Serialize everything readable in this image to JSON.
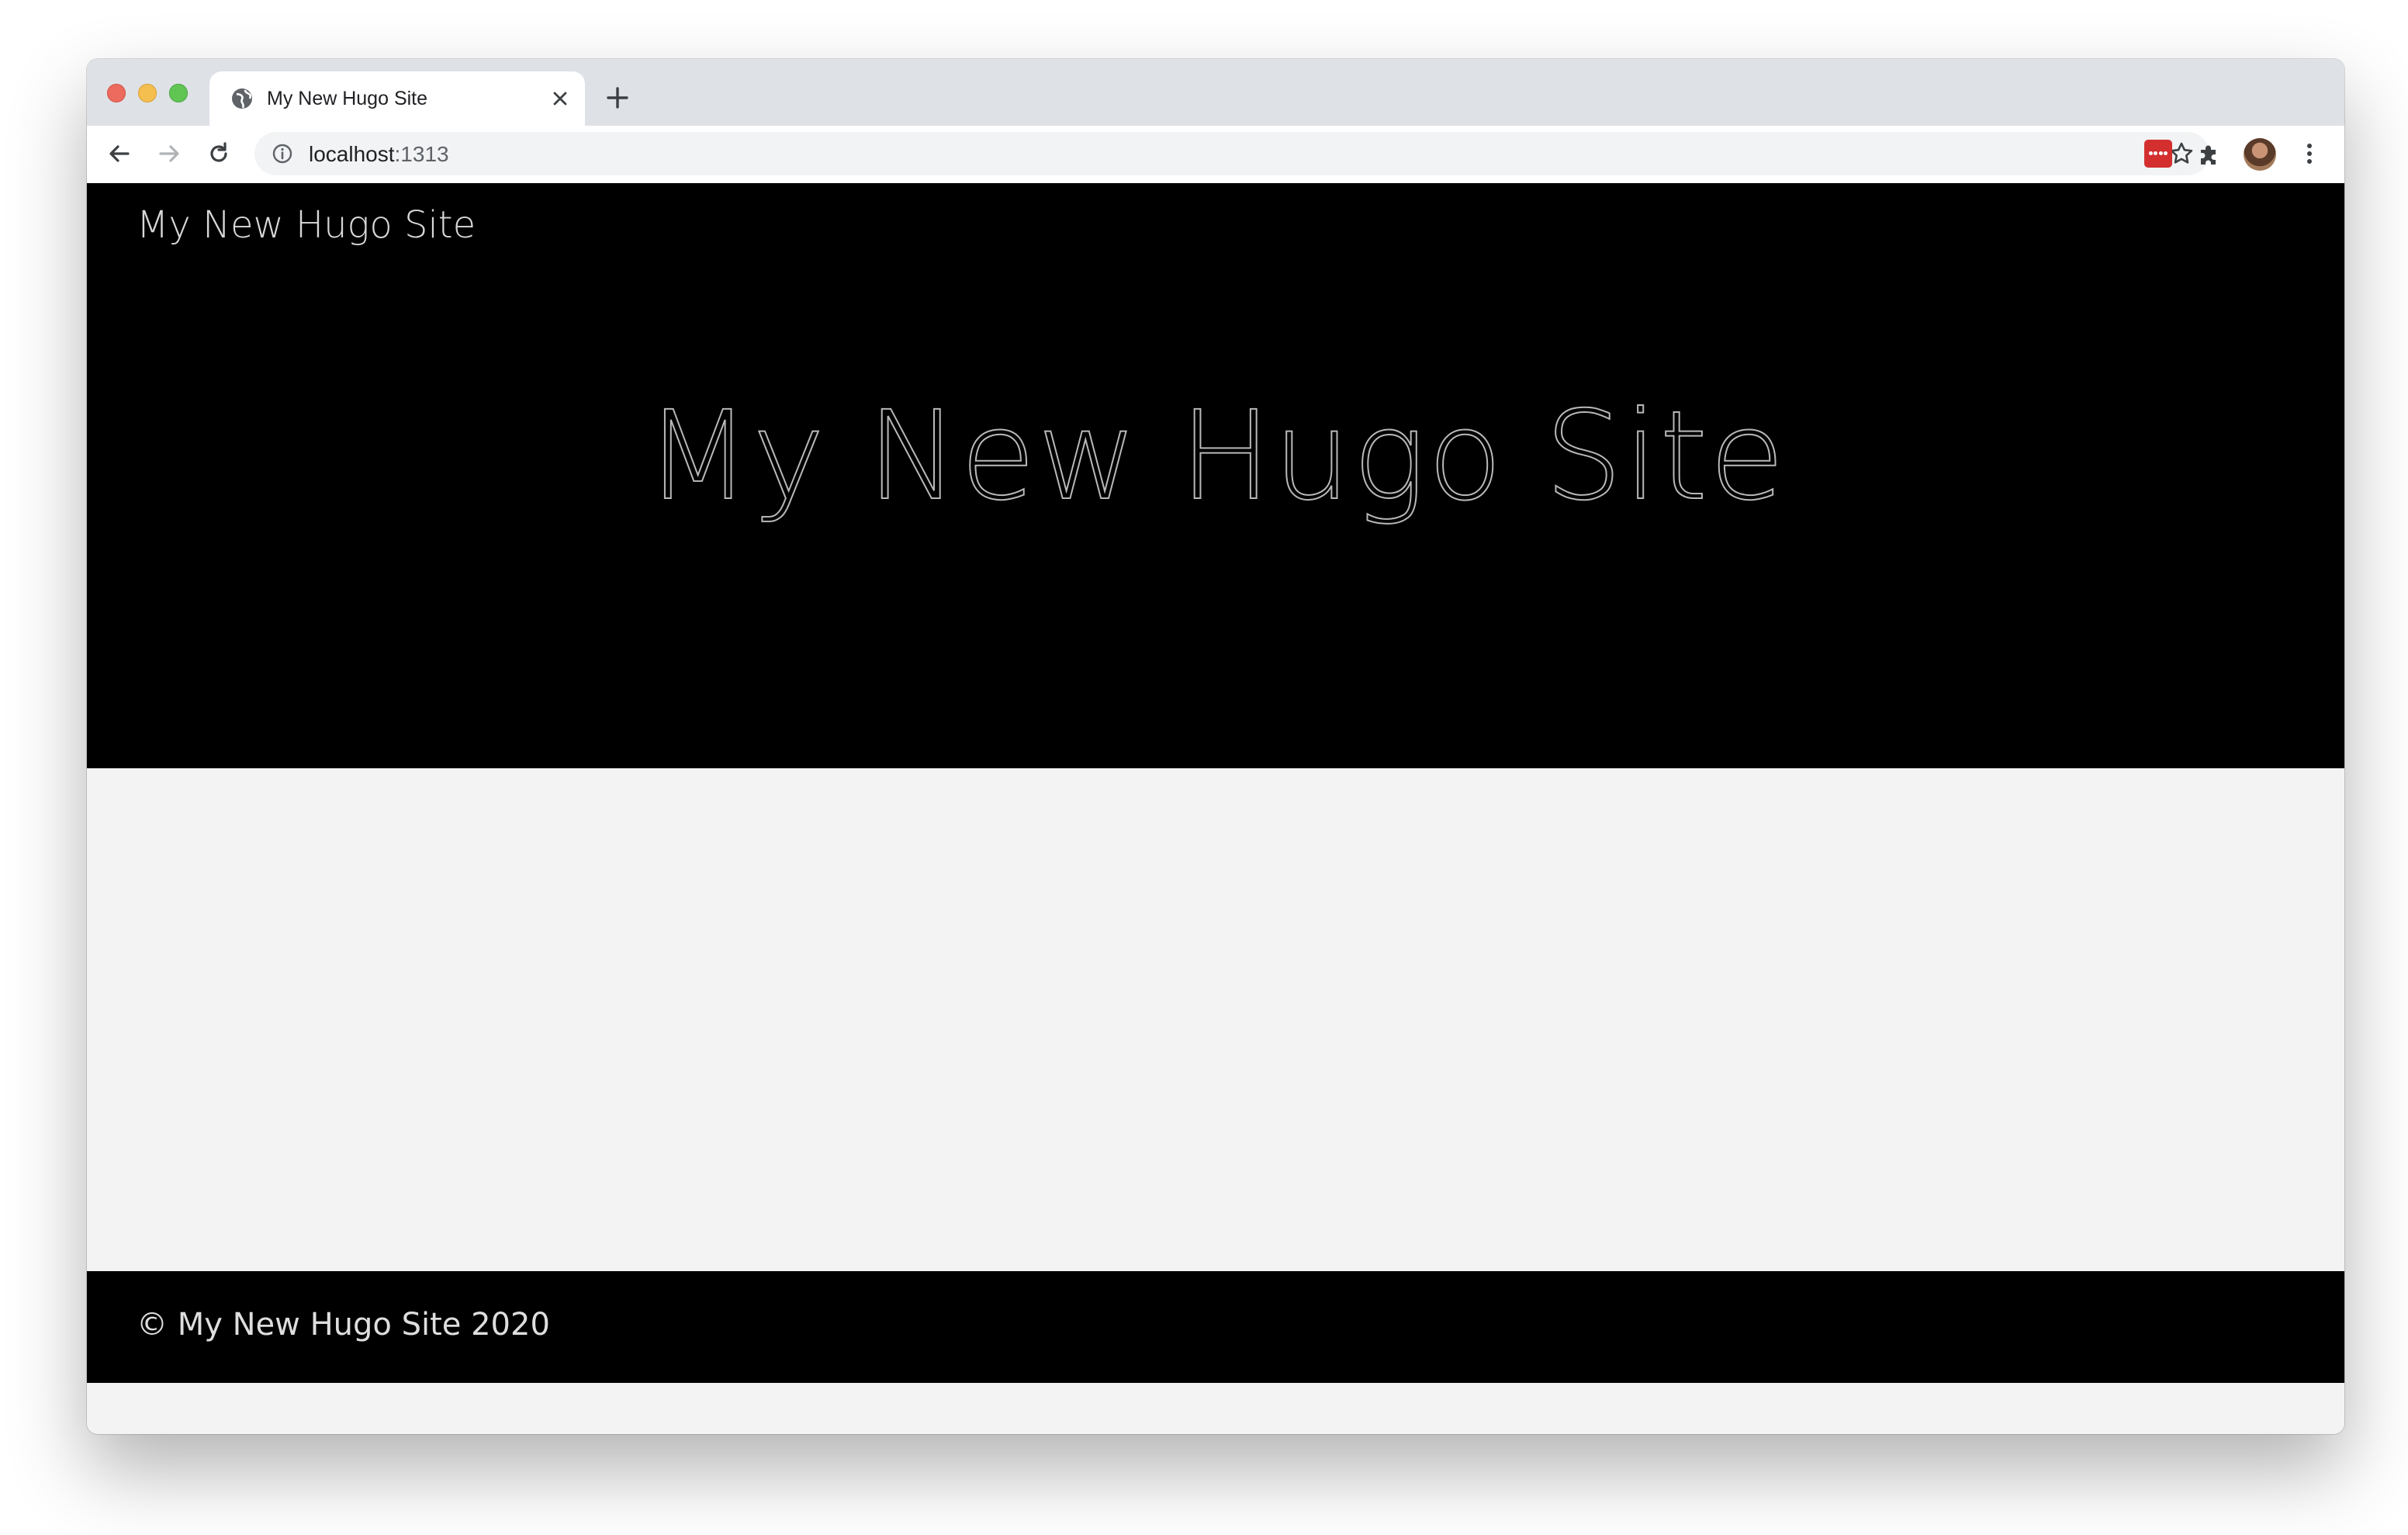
{
  "browser": {
    "tab": {
      "title": "My New Hugo Site",
      "favicon": "globe-icon"
    },
    "address_bar": {
      "host": "localhost",
      "port": ":1313"
    },
    "toolbar_icons": [
      "back-arrow-icon",
      "forward-arrow-icon",
      "reload-icon",
      "info-icon",
      "bookmark-star-icon",
      "extension-icon",
      "puzzle-icon",
      "avatar",
      "more-vert-icon"
    ]
  },
  "page": {
    "nav_title": "My New Hugo Site",
    "hero_title": "My New Hugo Site",
    "footer_text": "© My New Hugo Site 2020"
  },
  "colors": {
    "hero_background": "#000000",
    "body_background": "#f3f3f3",
    "footer_background": "#000000",
    "extension_red": "#d32f2f"
  }
}
